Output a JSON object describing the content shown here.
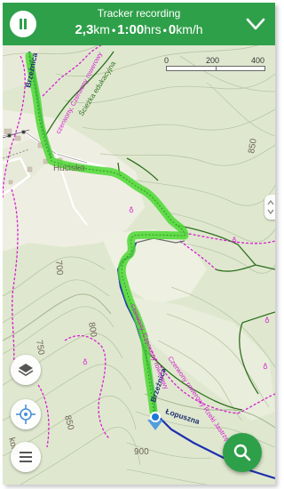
{
  "header": {
    "title": "Tracker recording",
    "distance_value": "2,3",
    "distance_unit": "km",
    "duration_value": "1:00",
    "duration_unit": "hrs",
    "speed_value": "0",
    "speed_unit": "km/h",
    "separator": "•"
  },
  "scale": {
    "labels": [
      "0",
      "200",
      "400"
    ]
  },
  "map": {
    "place_labels": [
      "Hucisko"
    ],
    "contour_labels": [
      "850",
      "700",
      "800",
      "750",
      "850",
      "900"
    ],
    "road_labels": [
      "Brzeźnica",
      "Łopuszna",
      "Brzeźnica"
    ],
    "trail_labels": [
      "czerwony, Czerwony rowerowy",
      "czerwony, Czerwony rowerowy",
      "Czerwony rowerowy Rzeki Jastrzębie"
    ],
    "edu_trail_label": "Ścieżka edukacyjna",
    "partial_label": "korb"
  },
  "colors": {
    "accent": "#2fa04a",
    "track": "#4cd832",
    "route_blue": "#1e2fb0",
    "trail_magenta": "#d61fd0",
    "map_bg": "#dfe8cf"
  },
  "icons": {
    "pause": "pause-icon",
    "collapse": "chevron-down-icon",
    "layers": "layers-icon",
    "locate": "locate-icon",
    "menu": "menu-icon",
    "search": "search-icon"
  }
}
